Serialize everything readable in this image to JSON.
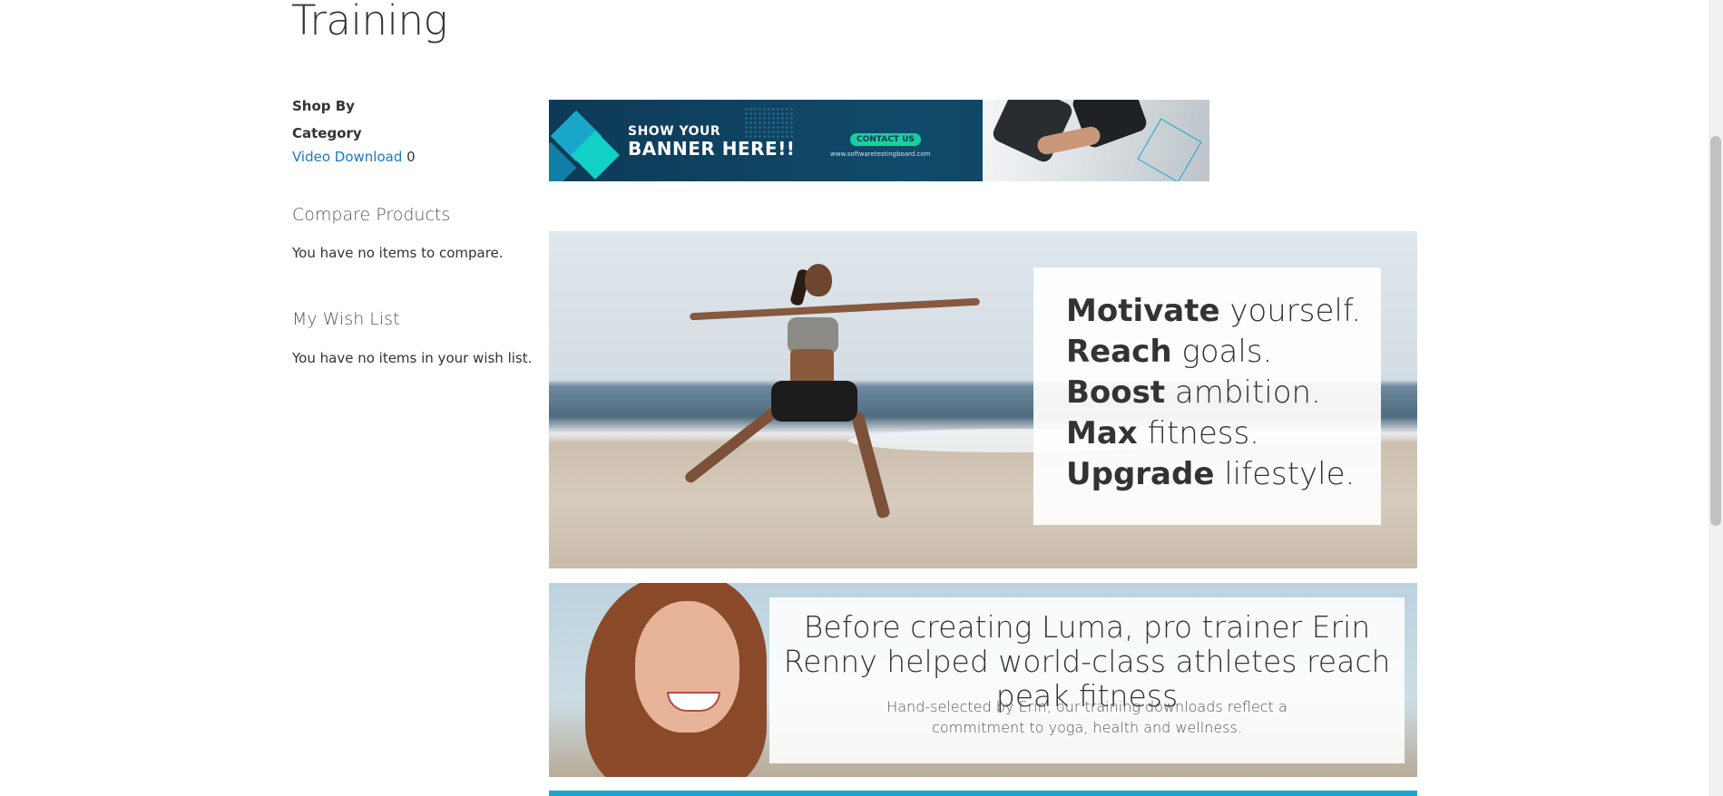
{
  "page": {
    "title": "Training"
  },
  "sidebar": {
    "shop_by": "Shop By",
    "category": "Category",
    "filter": {
      "label": "Video Download",
      "count": "0"
    },
    "compare": {
      "title": "Compare Products",
      "empty": "You have no items to compare."
    },
    "wishlist": {
      "title": "My Wish List",
      "empty": "You have no items in your wish list."
    }
  },
  "promo": {
    "line1": "SHOW YOUR",
    "line2": "BANNER HERE!!",
    "contact": "CONTACT US",
    "url": "www.softwaretestingboard.com"
  },
  "hero": {
    "lines": [
      {
        "bold": "Motivate",
        "rest": " yourself."
      },
      {
        "bold": "Reach",
        "rest": " goals."
      },
      {
        "bold": "Boost",
        "rest": " ambition."
      },
      {
        "bold": "Max",
        "rest": " fitness."
      },
      {
        "bold": "Upgrade",
        "rest": " lifestyle."
      }
    ]
  },
  "trainer": {
    "heading": "Before creating Luma, pro trainer Erin Renny helped world-class athletes reach peak fitness",
    "subtext": "Hand-selected by Erin, our training downloads reflect a commitment to yoga, health and wellness."
  },
  "colors": {
    "link": "#1979c3",
    "accent_bar": "#1aa7cf"
  }
}
